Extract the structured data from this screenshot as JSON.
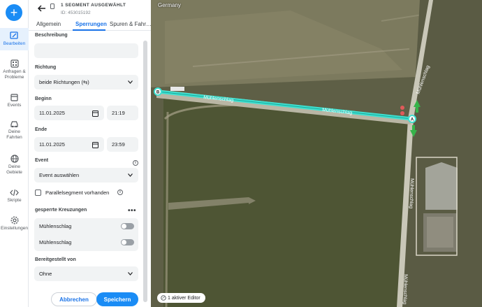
{
  "rail": {
    "items": [
      {
        "label": "Bearbeiten",
        "icon": "map-edit-icon"
      },
      {
        "label": "Anfragen & Probleme",
        "icon": "requests-icon"
      },
      {
        "label": "Events",
        "icon": "calendar-icon"
      },
      {
        "label": "Deine Fahrten",
        "icon": "car-icon"
      },
      {
        "label": "Deine Gebiete",
        "icon": "globe-icon"
      },
      {
        "label": "Skripte",
        "icon": "code-icon"
      },
      {
        "label": "Einstellungen",
        "icon": "gear-icon"
      }
    ]
  },
  "header": {
    "title": "1 SEGMENT AUSGEWÄHLT",
    "id": "ID: 453015192"
  },
  "tabs": [
    "Allgemein",
    "Sperrungen",
    "Spuren & Fahr…"
  ],
  "form": {
    "beschreibung_label": "Beschreibung",
    "beschreibung_value": "",
    "richtung_label": "Richtung",
    "richtung_value": "beide Richtungen (⇆)",
    "beginn_label": "Beginn",
    "beginn_date": "11.01.2025",
    "beginn_time": "21:19",
    "ende_label": "Ende",
    "ende_date": "11.01.2025",
    "ende_time": "23:59",
    "event_label": "Event",
    "event_value": "Event auswählen",
    "parallel_label": "Parallelsegment vorhanden",
    "kreuzungen_label": "gesperrte Kreuzungen",
    "kreuzungen": [
      {
        "name": "Mühlenschlag",
        "enabled": false
      },
      {
        "name": "Mühlenschlag",
        "enabled": false
      }
    ],
    "bereit_label": "Bereitgestellt von",
    "bereit_value": "Ohne"
  },
  "buttons": {
    "cancel": "Abbrechen",
    "save": "Speichern"
  },
  "map": {
    "country": "Germany",
    "editors": "1 aktiver Editor",
    "street_labels": [
      "Mühlenschlag",
      "Mühlenschlag",
      "Mühlenschlag",
      "Mühlenschlag",
      "Mühlenschlag"
    ],
    "node_a": "A",
    "node_b": "B",
    "colors": {
      "selected_segment": "#3fe0d0",
      "accent": "#1a8cf5"
    }
  }
}
